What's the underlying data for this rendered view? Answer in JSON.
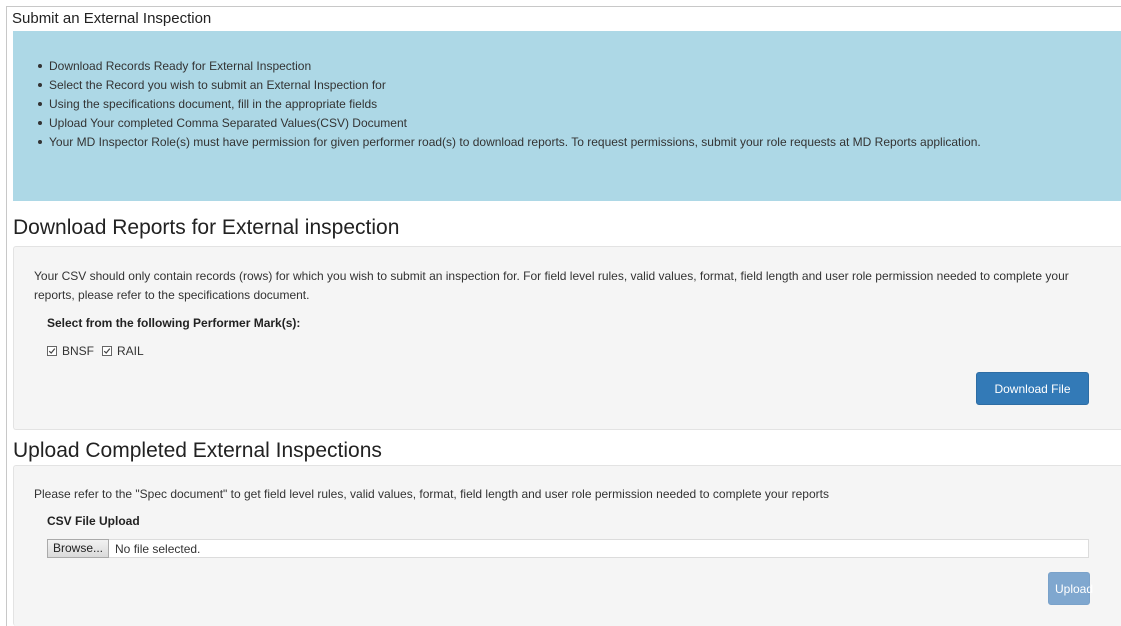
{
  "page": {
    "title": "Submit an External Inspection"
  },
  "instructions": [
    "Download Records Ready for External Inspection",
    "Select the Record you wish to submit an External Inspection for",
    "Using the specifications document, fill in the appropriate fields",
    "Upload Your completed Comma Separated Values(CSV) Document",
    "Your MD Inspector Role(s) must have permission for given performer road(s) to download reports. To request permissions, submit your role requests at MD Reports application."
  ],
  "download_section": {
    "heading": "Download Reports for External inspection",
    "description": "Your CSV should only contain records (rows) for which you wish to submit an inspection for. For field level rules, valid values, format, field length and user role permission needed to complete your reports, please refer to the specifications document.",
    "marks_label": "Select from the following Performer Mark(s):",
    "marks": [
      {
        "label": "BNSF",
        "checked": true
      },
      {
        "label": "RAIL",
        "checked": true
      }
    ],
    "button_label": "Download File"
  },
  "upload_section": {
    "heading": "Upload Completed External Inspections",
    "description": "Please refer to the \"Spec document\" to get field level rules, valid values, format, field length and user role permission needed to complete your reports",
    "file_label": "CSV File Upload",
    "browse_label": "Browse...",
    "file_status": "No file selected.",
    "button_label": "Upload"
  },
  "colors": {
    "info_background": "#add8e6",
    "primary_button": "#337ab7",
    "disabled_button": "#7fa7cf",
    "well_background": "#f5f5f5"
  }
}
